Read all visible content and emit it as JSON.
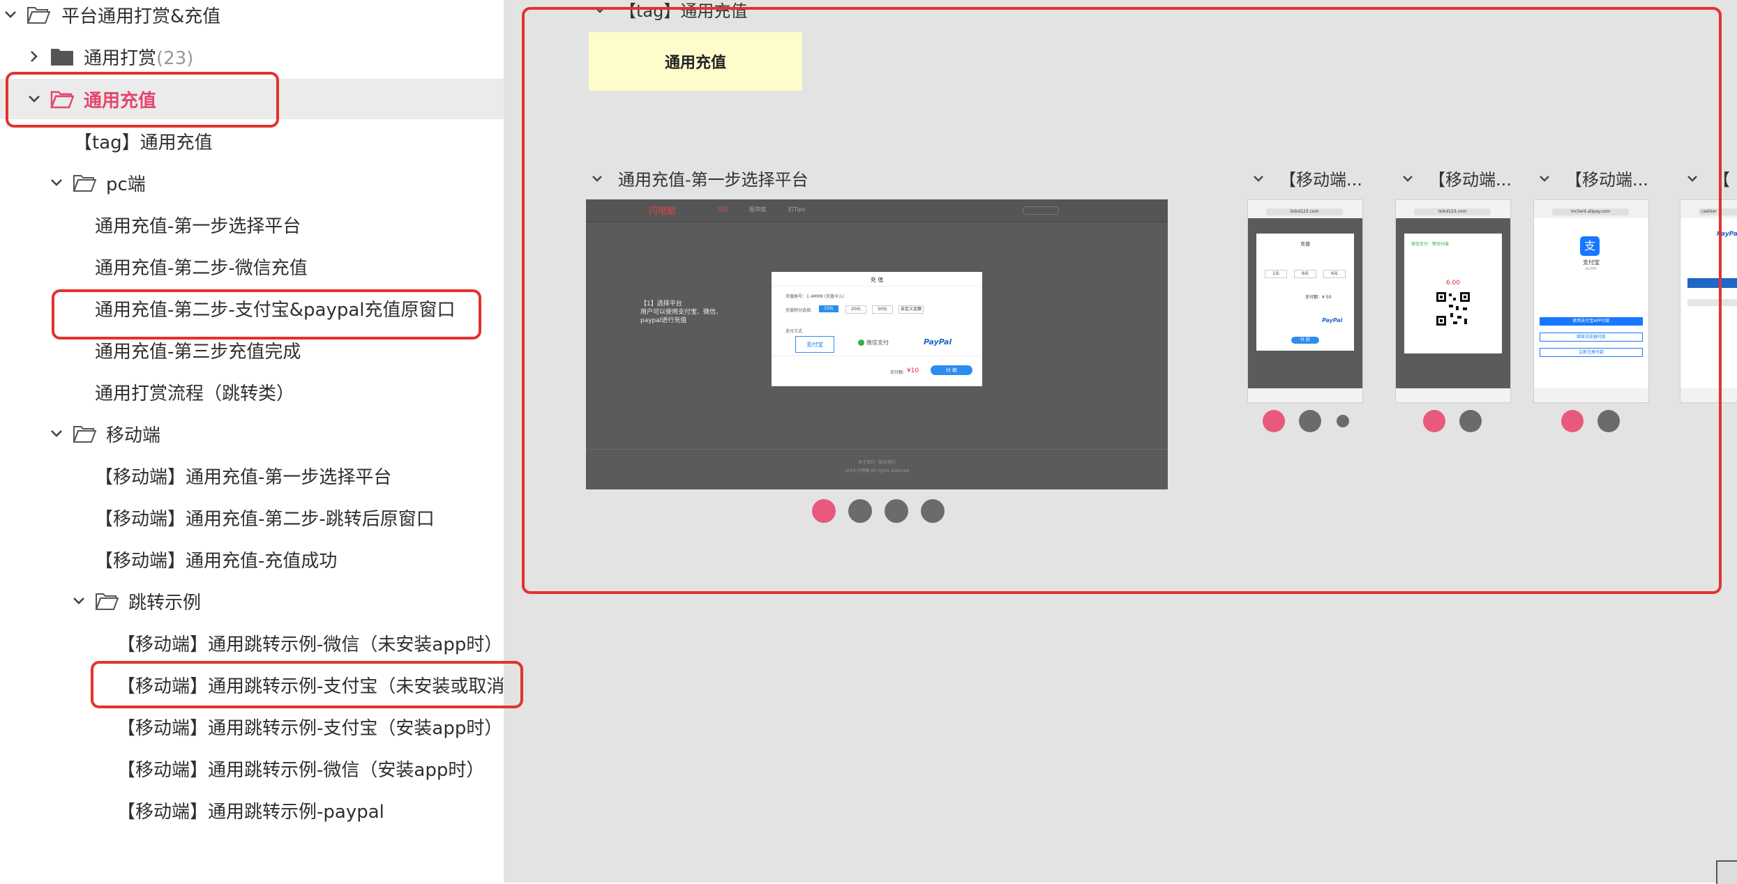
{
  "sidebar": {
    "root": "平台通用打赏&充值",
    "tip": {
      "label": "通用打赏",
      "count": "(23)"
    },
    "recharge": "通用充值",
    "tag": "【tag】通用充值",
    "pc": {
      "label": "pc端",
      "items": [
        "通用充值-第一步选择平台",
        "通用充值-第二步-微信充值",
        "通用充值-第二步-支付宝&paypal充值原窗口",
        "通用充值-第三步充值完成",
        "通用打赏流程（跳转类）"
      ]
    },
    "mobile": {
      "label": "移动端",
      "items": [
        "【移动端】通用充值-第一步选择平台",
        "【移动端】通用充值-第二步-跳转后原窗口",
        "【移动端】通用充值-充值成功"
      ]
    },
    "jump": {
      "label": "跳转示例",
      "items": [
        "【移动端】通用跳转示例-微信（未安装app时）",
        "【移动端】通用跳转示例-支付宝（未安装或取消",
        "【移动端】通用跳转示例-支付宝（安装app时）",
        "【移动端】通用跳转示例-微信（安装app时）",
        "【移动端】通用跳转示例-paypal"
      ]
    }
  },
  "canvas": {
    "tag_header": "【tag】通用充值",
    "sticky_note": "通用充值",
    "frame1_title": "通用充值-第一步选择平台",
    "mobile_titles": [
      "【移动端...",
      "【移动端...",
      "【移动端...",
      "【"
    ],
    "mock": {
      "logo": "闪电献",
      "nav": [
        "首页",
        "图书馆",
        "打Tips"
      ],
      "modal_title": "充 值",
      "account_line": "充值账号：1.4MM8 (充值卡么)",
      "amount_label": "充值积分选择:",
      "amounts": [
        "10元",
        "20元",
        "50元",
        "自定义金额"
      ],
      "pay_label": "支付方式",
      "alipay": "支付宝",
      "wechat": "微信支付",
      "paypal": "PayPal",
      "total_label": "支付额:",
      "total_value": "¥10",
      "pay_button": "付 款",
      "side_note": "【1】选择平台\n用户可以使用支付宝、微信、paypal进行充值",
      "footer1": "关于我们 · 联系我们",
      "footer2": "2014 闪电献 All rights reserved"
    },
    "m1": {
      "url": "linkd123.com",
      "title": "充值",
      "amounts": [
        "1元",
        "6元",
        "6元"
      ],
      "total": "支付额：¥ 50",
      "button": "付 款",
      "paypal": "PayPal"
    },
    "m2": {
      "url": "linkd123.com",
      "status": "微信支付 · 等待扫描",
      "amount": "6.00"
    },
    "m3": {
      "url": "mclient.alipay.com",
      "brand": "支付宝",
      "brand_en": "ALIPAY",
      "btn1": "使用支付宝APP付款",
      "btn2": "继续浏览器付款",
      "btn3": "立即注册付款"
    },
    "m4": {
      "url": "cashier",
      "brand": "PayPal"
    },
    "colors": {
      "accent_red": "#e3322f",
      "pink": "#e8597b",
      "sticky": "#fffccc",
      "selected_text": "#e5456c"
    }
  }
}
